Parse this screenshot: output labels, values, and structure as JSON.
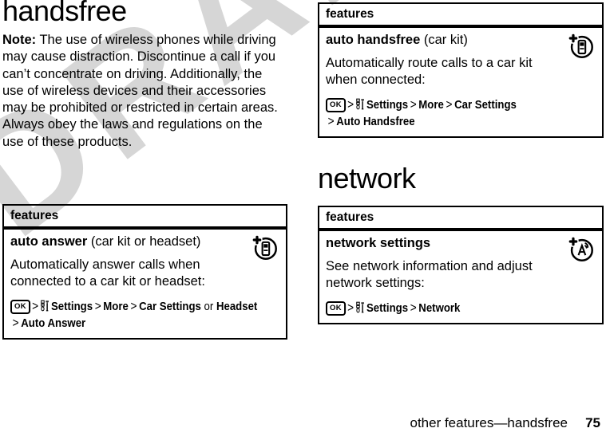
{
  "document": {
    "watermark": "DRAFT",
    "watermark_color": "#d6d6d6",
    "text_color": "#000000",
    "background_color": "#ffffff"
  },
  "footer": {
    "title": "other features—handsfree",
    "page_number": "75"
  },
  "left_column": {
    "heading": "handsfree",
    "note": {
      "label": "Note:",
      "text": " The use of wireless phones while driving may cause distraction. Discontinue a call if you can’t concentrate on driving. Additionally, the use of wireless devices and their accessories may be prohibited or restricted in certain areas. Always obey the laws and regulations on the use of these products."
    },
    "table": {
      "header": "features",
      "row": {
        "title_bold": "auto answer",
        "title_normal": " (car kit or headset)",
        "description": "Automatically answer calls when connected to a car kit or headset:",
        "path": {
          "key_label": "OK",
          "settings_icon": "tools-icon",
          "segments": [
            {
              "text": "Settings",
              "bold": true
            },
            {
              "text": "More",
              "bold": true
            },
            {
              "text": "Car Settings",
              "bold": true
            },
            {
              "text": "or",
              "bold": false,
              "inline": true
            },
            {
              "text": "Headset",
              "bold": true,
              "inline": true
            },
            {
              "text": "Auto Answer",
              "bold": true
            }
          ],
          "separator": ">"
        },
        "icon": "car-kit-headset-phone-icon"
      }
    }
  },
  "right_column": {
    "table_handsfree": {
      "header": "features",
      "row": {
        "title_bold": "auto handsfree",
        "title_normal": " (car kit)",
        "description": "Automatically route calls to a car kit when connected:",
        "path": {
          "key_label": "OK",
          "settings_icon": "tools-icon",
          "segments": [
            {
              "text": "Settings",
              "bold": true
            },
            {
              "text": "More",
              "bold": true
            },
            {
              "text": "Car Settings",
              "bold": true
            },
            {
              "text": "Auto Handsfree",
              "bold": true
            }
          ],
          "separator": ">"
        },
        "icon": "car-kit-phone-icon"
      }
    },
    "heading": "network",
    "table_network": {
      "header": "features",
      "row": {
        "title_bold": "network settings",
        "title_normal": "",
        "description": "See network information and adjust network settings:",
        "path": {
          "key_label": "OK",
          "settings_icon": "tools-icon",
          "segments": [
            {
              "text": "Settings",
              "bold": true
            },
            {
              "text": "Network",
              "bold": true
            }
          ],
          "separator": ">"
        },
        "icon": "network-antenna-icon"
      }
    }
  }
}
